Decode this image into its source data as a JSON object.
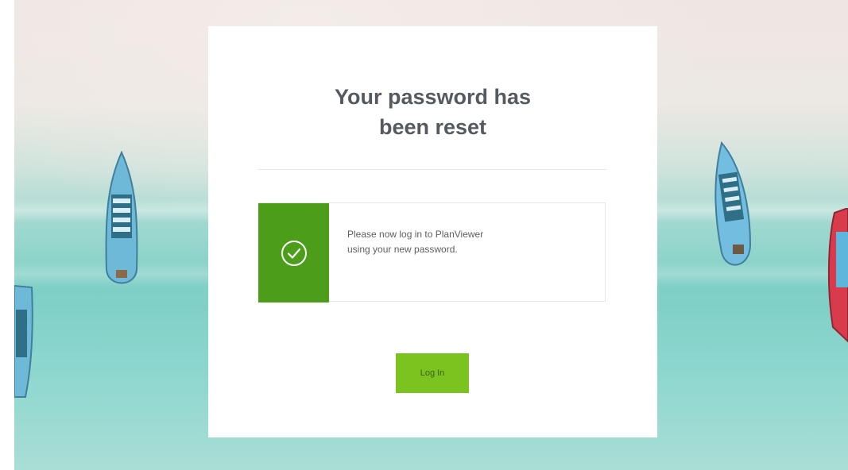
{
  "card": {
    "title_line1": "Your password has",
    "title_line2": "been reset"
  },
  "alert": {
    "icon": "check-circle-icon",
    "line1": "Please now log in to PlanViewer",
    "line2": "using your new password.",
    "accent_color": "#4c9e1a"
  },
  "actions": {
    "login_label": "Log In",
    "button_color": "#7bc420"
  },
  "background": {
    "description_colors": [
      "#efe6e3",
      "#7ecfc6"
    ]
  }
}
